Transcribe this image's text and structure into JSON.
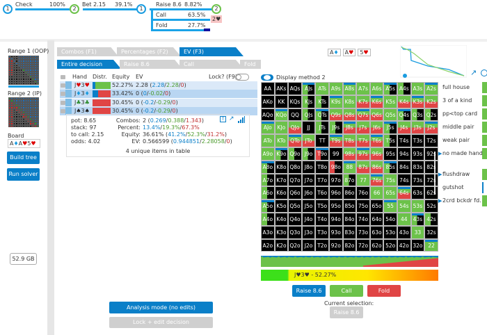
{
  "tree": {
    "nodes": [
      "1",
      "2",
      "1",
      "2"
    ],
    "edges": [
      {
        "label": "Check",
        "pct": "100%"
      },
      {
        "label": "Bet 2.15",
        "pct": "39.1%"
      },
      {
        "label": "Raise 8.6",
        "pct": "8.82%"
      },
      {
        "label": "Call",
        "pct": "63.5%"
      },
      {
        "label": "Fold",
        "pct": "27.7%"
      }
    ],
    "call_result": "2♥"
  },
  "sidebar": {
    "range1": "Range 1 (OOP)",
    "range2": "Range 2 (IP)",
    "board_label": "Board",
    "board_cards": [
      {
        "r": "A",
        "s": "♦",
        "c": "#1a9ce0"
      },
      {
        "r": "A",
        "s": "♥",
        "c": "#d00"
      },
      {
        "r": "5",
        "s": "♥",
        "c": "#d00"
      }
    ],
    "build": "Build tree",
    "run": "Run solver",
    "memory": "52.9 GB"
  },
  "tabs1": [
    "Combos (F1)",
    "Percentages (F2)",
    "EV (F3)"
  ],
  "tabs2": [
    "Entire decision",
    "Raise 8.6",
    "Call",
    "Fold"
  ],
  "table": {
    "headers": {
      "hand": "Hand",
      "distr": "Distr.",
      "equity": "Equity",
      "ev": "EV"
    },
    "lock_label": "Lock? (F9)",
    "rows": [
      {
        "r1": "J",
        "s1": "♥",
        "r2": "3",
        "s2": "♥",
        "c": "#d00",
        "eq": "52.27%",
        "ev": "2.28",
        "a": "2.28",
        "b": "2.28",
        "z": "0",
        "dist": [
          0.15,
          0.85,
          0
        ]
      },
      {
        "r1": "J",
        "s1": "♦",
        "r2": "3",
        "s2": "♦",
        "c": "#1a9ce0",
        "eq": "33.42%",
        "ev": "0",
        "a": "0",
        "b": "-0.02",
        "z": "0",
        "dist": [
          0.3,
          0,
          0.7
        ]
      },
      {
        "r1": "J",
        "s1": "♣",
        "r2": "3",
        "s2": "♣",
        "c": "#2a8a2a",
        "eq": "30.45%",
        "ev": "0",
        "a": "-0.2",
        "b": "-0.29",
        "z": "0",
        "dist": [
          0,
          0,
          1
        ]
      },
      {
        "r1": "J",
        "s1": "♠",
        "r2": "3",
        "s2": "♠",
        "c": "#222",
        "eq": "30.45%",
        "ev": "0",
        "a": "-0.2",
        "b": "-0.29",
        "z": "0",
        "dist": [
          0,
          0,
          1
        ]
      }
    ]
  },
  "info": {
    "pot": "pot: 8.65",
    "stack": "stack: 97",
    "tocall": "to call: 2.15",
    "odds": "odds: 4.02",
    "combos_l": "Combos:",
    "combos": "2",
    "combos_parts": [
      "0.269",
      "0.388",
      "1.343"
    ],
    "percent_l": "Percent:",
    "percent_parts": [
      "13.4%",
      "19.3%",
      "67.3%"
    ],
    "equity_l": "Equity:",
    "equity": "36.61%",
    "equity_parts": [
      "41.2%",
      "52.3%",
      "31.2%"
    ],
    "ev_l": "EV:",
    "ev": "0.566599",
    "ev_parts": [
      "0.944851",
      "2.28058",
      "0"
    ],
    "unique": "4 unique items in table"
  },
  "board_cards": [
    {
      "r": "A",
      "s": "♦",
      "c": "#1a9ce0"
    },
    {
      "r": "A",
      "s": "♥",
      "c": "#d00"
    },
    {
      "r": "5",
      "s": "♥",
      "c": "#d00"
    }
  ],
  "display_method": "Display method 2",
  "colors": {
    "raise": "#0a7fc8",
    "call": "#6cc24a",
    "fold": "#e04545"
  },
  "grid": {
    "labels": [
      [
        "AA",
        "AKs",
        "AQs",
        "AJs",
        "ATs",
        "A9s",
        "A8s",
        "A7s",
        "A6s",
        "A5s",
        "A4s",
        "A3s",
        "A2s"
      ],
      [
        "AKo",
        "KK",
        "KQs",
        "KJs",
        "KTs",
        "K9s",
        "K8s",
        "K7s",
        "K6s",
        "K5s",
        "K4s",
        "K3s",
        "K2s"
      ],
      [
        "AQo",
        "KQo",
        "QQ",
        "QJs",
        "QTs",
        "Q9s",
        "Q8s",
        "Q7s",
        "Q6s",
        "Q5s",
        "Q4s",
        "Q3s",
        "Q2s"
      ],
      [
        "AJo",
        "KJo",
        "QJo",
        "JJ",
        "JTs",
        "J9s",
        "J8s",
        "J7s",
        "J6s",
        "J5s",
        "J4s",
        "J3s",
        "J2s"
      ],
      [
        "ATo",
        "KTo",
        "QTo",
        "JTo",
        "TT",
        "T9s",
        "T8s",
        "T7s",
        "T6s",
        "T5s",
        "T4s",
        "T3s",
        "T2s"
      ],
      [
        "A9o",
        "K9o",
        "Q9o",
        "J9o",
        "T9o",
        "99",
        "98s",
        "97s",
        "96s",
        "95s",
        "94s",
        "93s",
        "92s"
      ],
      [
        "A8o",
        "K8o",
        "Q8o",
        "J8o",
        "T8o",
        "98o",
        "88",
        "87s",
        "86s",
        "85s",
        "84s",
        "83s",
        "82s"
      ],
      [
        "A7o",
        "K7o",
        "Q7o",
        "J7o",
        "T7o",
        "97o",
        "87o",
        "77",
        "76s",
        "75s",
        "74s",
        "73s",
        "72s"
      ],
      [
        "A6o",
        "K6o",
        "Q6o",
        "J6o",
        "T6o",
        "96o",
        "86o",
        "76o",
        "66",
        "65s",
        "64s",
        "63s",
        "62s"
      ],
      [
        "A5o",
        "K5o",
        "Q5o",
        "J5o",
        "T5o",
        "95o",
        "85o",
        "75o",
        "65o",
        "55",
        "54s",
        "53s",
        "52s"
      ],
      [
        "A4o",
        "K4o",
        "Q4o",
        "J4o",
        "T4o",
        "94o",
        "84o",
        "74o",
        "64o",
        "54o",
        "44",
        "43s",
        "42s"
      ],
      [
        "A3o",
        "K3o",
        "Q3o",
        "J3o",
        "T3o",
        "93o",
        "83o",
        "73o",
        "63o",
        "53o",
        "43o",
        "33",
        "32s"
      ],
      [
        "A2o",
        "K2o",
        "Q2o",
        "J2o",
        "T2o",
        "92o",
        "82o",
        "72o",
        "62o",
        "52o",
        "42o",
        "32o",
        "22"
      ]
    ],
    "strategy": [
      "kkkhggggghhgg",
      "kkkhhggmmgmmm",
      "kgkhhmmmmghhh",
      "ggmkhhmmmhmmm",
      "ggmmkmmmmhkkk",
      "ghhhpkmmmkkkk",
      "hkkkkpgmmhkkk",
      "hkkkkkhgmgkkk",
      "hkkkkkkkggmkk",
      "hkkkkkkkkgggk",
      "hkkkkkkkkkghh",
      "kkkkkkkkkkkgk",
      "kkkkkkkkkkkkg"
    ]
  },
  "equity_bar": "J♥3♥ - 52.27%",
  "actions": [
    "Raise 8.6",
    "Call",
    "Fold"
  ],
  "current_selection": "Current selection:",
  "selected": "Raise 8.6",
  "categories": [
    "full house",
    "3 of a kind",
    "pp<top card",
    "middle pair",
    "weak pair",
    "no made hand",
    "flushdraw",
    "gutshot",
    "2crd bckdr fd."
  ],
  "bottom": {
    "analysis": "Analysis mode (no edits)",
    "lock_edit": "Lock + edit decision"
  }
}
